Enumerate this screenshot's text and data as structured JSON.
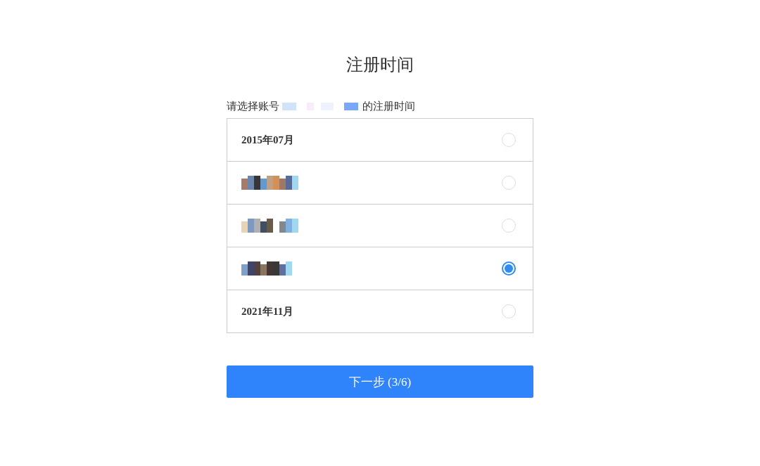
{
  "title": "注册时间",
  "prompt": {
    "before": "请选择账号",
    "after": "的注册时间"
  },
  "options": [
    {
      "kind": "text",
      "label": "2015年07月",
      "selected": false
    },
    {
      "kind": "redacted",
      "selected": false
    },
    {
      "kind": "redacted",
      "selected": false
    },
    {
      "kind": "redacted",
      "selected": true
    },
    {
      "kind": "text",
      "label": "2021年11月",
      "selected": false
    }
  ],
  "next_button": "下一步 (3/6)"
}
